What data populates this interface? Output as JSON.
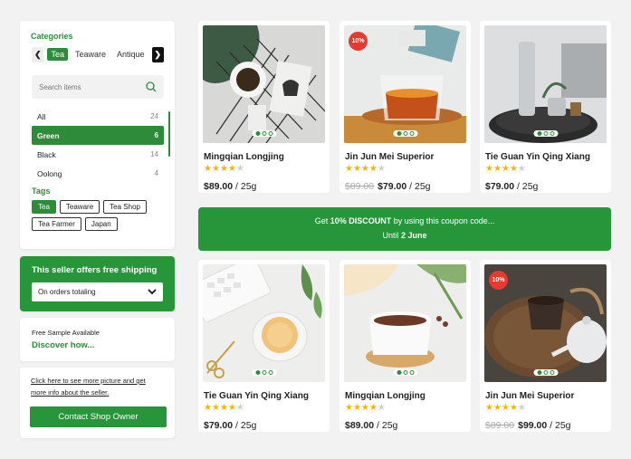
{
  "sidebar": {
    "categories_label": "Categories",
    "category_tabs": [
      "Tea",
      "Teaware",
      "Antique"
    ],
    "search_placeholder": "Search items",
    "category_list": [
      {
        "name": "All",
        "count": "24"
      },
      {
        "name": "Green",
        "count": "6"
      },
      {
        "name": "Black",
        "count": "14"
      },
      {
        "name": "Oolong",
        "count": "4"
      }
    ],
    "tags_label": "Tags",
    "tags": [
      "Tea",
      "Teaware",
      "Tea Shop",
      "Tea Farmer",
      "Japan"
    ]
  },
  "shipping": {
    "title": "This seller offers free shipping",
    "select_value": "On orders totaling"
  },
  "sample": {
    "text": "Free Sample Available",
    "link": "Discover how..."
  },
  "contact": {
    "info_line1": "Click here to see more picture and get",
    "info_line2": "more info about the seller.",
    "button": "Contact Shop Owner"
  },
  "promo": {
    "prefix": "Get ",
    "highlight": "10% DISCOUNT",
    "suffix": " by using this coupon code...",
    "until": "Until ",
    "date": "2 June"
  },
  "products": [
    {
      "name": "Mingqian Longjing",
      "rating": 4,
      "old_price": "",
      "price": "$89.00",
      "unit": " / 25g",
      "badge": ""
    },
    {
      "name": "Jin Jun Mei Superior",
      "rating": 4,
      "old_price": "$89.00",
      "price": "$79.00",
      "unit": " / 25g",
      "badge": "10%"
    },
    {
      "name": "Tie Guan Yin Qing Xiang",
      "rating": 4,
      "old_price": "",
      "price": "$79.00",
      "unit": " / 25g",
      "badge": ""
    },
    {
      "name": "Tie Guan Yin Qing Xiang",
      "rating": 4,
      "old_price": "",
      "price": "$79.00",
      "unit": " / 25g",
      "badge": ""
    },
    {
      "name": "Mingqian Longjing",
      "rating": 4,
      "old_price": "",
      "price": "$89.00",
      "unit": " / 25g",
      "badge": ""
    },
    {
      "name": "Jin Jun Mei Superior",
      "rating": 4,
      "old_price": "$89.00",
      "price": "$99.00",
      "unit": " / 25g",
      "badge": "10%"
    }
  ],
  "colors": {
    "brand_green": "#27953a",
    "badge_red": "#e53a2f",
    "star": "#f2b705"
  }
}
